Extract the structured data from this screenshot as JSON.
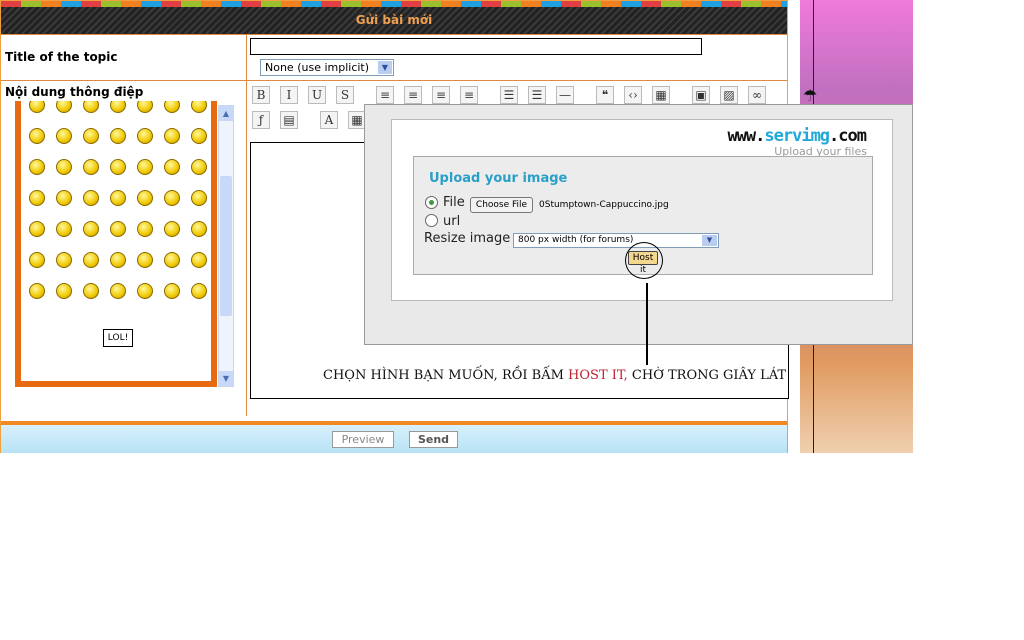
{
  "form": {
    "title": "Gửi bài mới",
    "topic_label": "Title of the topic",
    "topic_value": "",
    "icon_select": "None (use implicit)",
    "message_label": "Nội dung thông điệp",
    "smiley_sign": "LOL!",
    "toolbar": {
      "row1": [
        "B",
        "I",
        "U",
        "S",
        "align-left",
        "align-center",
        "align-right",
        "justify",
        "bullet-list",
        "numbered-list",
        "horizontal-rule",
        "quote",
        "code",
        "table",
        "image-host",
        "image",
        "link"
      ],
      "row2": [
        "flash",
        "video",
        "font",
        "color"
      ]
    },
    "preview_label": "Preview",
    "send_label": "Send"
  },
  "upload": {
    "logo_prefix": "www.",
    "logo_brand": "servimg",
    "logo_suffix": ".com",
    "tagline": "Upload your files",
    "heading": "Upload your image",
    "file_label": "File",
    "choose_label": "Choose File",
    "file_name": "0Stumptown-Cappuccino.jpg",
    "url_label": "url",
    "resize_label": "Resize image",
    "resize_value": "800 px width (for forums)",
    "host_label": "Host it",
    "source_selected": "file"
  },
  "caption": {
    "part1": "CHỌN HÌNH BẠN MUỐN, RỒI BẤM ",
    "highlight": "HOST IT,",
    "part2": " CHỜ TRONG GIÂY LÁT",
    "highlight_color": "#c02030"
  },
  "colors": {
    "accent": "#f08a20",
    "header_text": "#f0a050",
    "upload_heading": "#2a9fc8"
  }
}
